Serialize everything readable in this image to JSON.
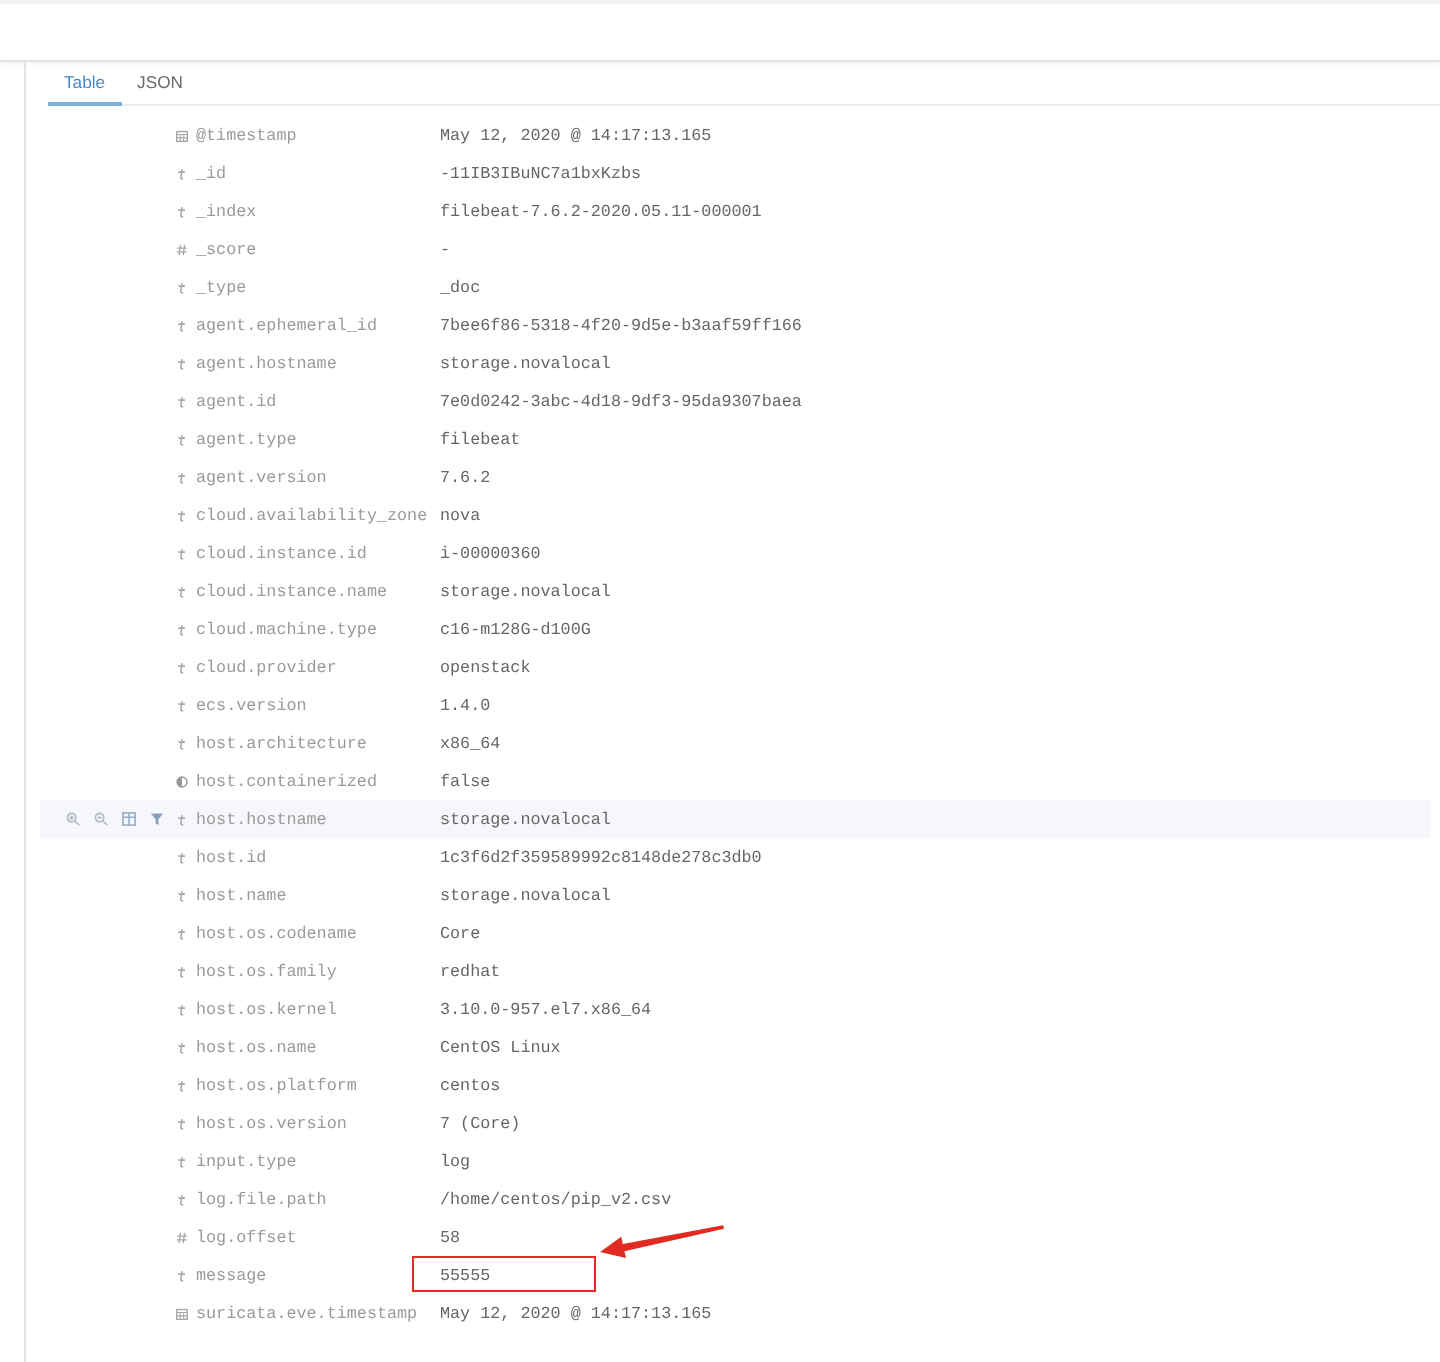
{
  "tabs": [
    {
      "label": "Table",
      "selected": true
    },
    {
      "label": "JSON",
      "selected": false
    }
  ],
  "fields": [
    {
      "kind": "date",
      "name": "@timestamp",
      "value": "May 12, 2020 @ 14:17:13.165",
      "hovered": false,
      "marked": false
    },
    {
      "kind": "string",
      "name": "_id",
      "value": "-11IB3IBuNC7a1bxKzbs",
      "hovered": false,
      "marked": false
    },
    {
      "kind": "string",
      "name": "_index",
      "value": "filebeat-7.6.2-2020.05.11-000001",
      "hovered": false,
      "marked": false
    },
    {
      "kind": "number",
      "name": "_score",
      "value": "-",
      "hovered": false,
      "marked": false
    },
    {
      "kind": "string",
      "name": "_type",
      "value": "_doc",
      "hovered": false,
      "marked": false
    },
    {
      "kind": "string",
      "name": "agent.ephemeral_id",
      "value": "7bee6f86-5318-4f20-9d5e-b3aaf59ff166",
      "hovered": false,
      "marked": false
    },
    {
      "kind": "string",
      "name": "agent.hostname",
      "value": "storage.novalocal",
      "hovered": false,
      "marked": false
    },
    {
      "kind": "string",
      "name": "agent.id",
      "value": "7e0d0242-3abc-4d18-9df3-95da9307baea",
      "hovered": false,
      "marked": false
    },
    {
      "kind": "string",
      "name": "agent.type",
      "value": "filebeat",
      "hovered": false,
      "marked": false
    },
    {
      "kind": "string",
      "name": "agent.version",
      "value": "7.6.2",
      "hovered": false,
      "marked": false
    },
    {
      "kind": "string",
      "name": "cloud.availability_zone",
      "value": "nova",
      "hovered": false,
      "marked": false
    },
    {
      "kind": "string",
      "name": "cloud.instance.id",
      "value": "i-00000360",
      "hovered": false,
      "marked": false
    },
    {
      "kind": "string",
      "name": "cloud.instance.name",
      "value": "storage.novalocal",
      "hovered": false,
      "marked": false
    },
    {
      "kind": "string",
      "name": "cloud.machine.type",
      "value": "c16-m128G-d100G",
      "hovered": false,
      "marked": false
    },
    {
      "kind": "string",
      "name": "cloud.provider",
      "value": "openstack",
      "hovered": false,
      "marked": false
    },
    {
      "kind": "string",
      "name": "ecs.version",
      "value": "1.4.0",
      "hovered": false,
      "marked": false
    },
    {
      "kind": "string",
      "name": "host.architecture",
      "value": "x86_64",
      "hovered": false,
      "marked": false
    },
    {
      "kind": "boolean",
      "name": "host.containerized",
      "value": "false",
      "hovered": false,
      "marked": false
    },
    {
      "kind": "string",
      "name": "host.hostname",
      "value": "storage.novalocal",
      "hovered": true,
      "marked": false
    },
    {
      "kind": "string",
      "name": "host.id",
      "value": "1c3f6d2f359589992c8148de278c3db0",
      "hovered": false,
      "marked": false
    },
    {
      "kind": "string",
      "name": "host.name",
      "value": "storage.novalocal",
      "hovered": false,
      "marked": false
    },
    {
      "kind": "string",
      "name": "host.os.codename",
      "value": "Core",
      "hovered": false,
      "marked": false
    },
    {
      "kind": "string",
      "name": "host.os.family",
      "value": "redhat",
      "hovered": false,
      "marked": false
    },
    {
      "kind": "string",
      "name": "host.os.kernel",
      "value": "3.10.0-957.el7.x86_64",
      "hovered": false,
      "marked": false
    },
    {
      "kind": "string",
      "name": "host.os.name",
      "value": "CentOS Linux",
      "hovered": false,
      "marked": false
    },
    {
      "kind": "string",
      "name": "host.os.platform",
      "value": "centos",
      "hovered": false,
      "marked": false
    },
    {
      "kind": "string",
      "name": "host.os.version",
      "value": "7 (Core)",
      "hovered": false,
      "marked": false
    },
    {
      "kind": "string",
      "name": "input.type",
      "value": "log",
      "hovered": false,
      "marked": false
    },
    {
      "kind": "string",
      "name": "log.file.path",
      "value": "/home/centos/pip_v2.csv",
      "hovered": false,
      "marked": false
    },
    {
      "kind": "number",
      "name": "log.offset",
      "value": "58",
      "hovered": false,
      "marked": false
    },
    {
      "kind": "string",
      "name": "message",
      "value": "55555",
      "hovered": false,
      "marked": true
    },
    {
      "kind": "date",
      "name": "suricata.eve.timestamp",
      "value": "May 12, 2020 @ 14:17:13.165",
      "hovered": false,
      "marked": false
    }
  ]
}
